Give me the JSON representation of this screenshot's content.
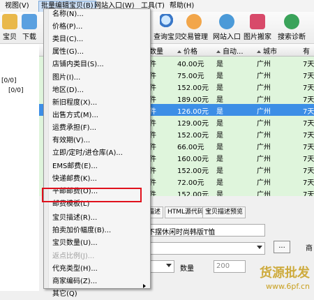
{
  "menubar": {
    "items": [
      "视图(V)",
      "批量编辑宝贝(B)",
      "网站入口(W)",
      "工具(T)",
      "帮助(H)"
    ]
  },
  "toolbar": {
    "items": [
      "宝贝",
      "下载",
      "查询宝贝",
      "交易管理",
      "网站入口",
      "图片搬家",
      "搜索诊断"
    ]
  },
  "lefttree": {
    "counts": [
      "[0/0]",
      "[0/0]"
    ]
  },
  "grid": {
    "headers": [
      "数量",
      "价格",
      "自动...",
      "城市",
      "有"
    ],
    "rows": [
      {
        "qty": "件",
        "price": "40.00元",
        "auto": "是",
        "city": "广州",
        "days": "7天"
      },
      {
        "qty": "件",
        "price": "75.00元",
        "auto": "是",
        "city": "广州",
        "days": "7天"
      },
      {
        "qty": "件",
        "price": "152.00元",
        "auto": "是",
        "city": "广州",
        "days": "7天"
      },
      {
        "qty": "件",
        "price": "189.00元",
        "auto": "是",
        "city": "广州",
        "days": "7天"
      },
      {
        "qty": "件",
        "price": "126.00元",
        "auto": "是",
        "city": "广州",
        "days": "7天"
      },
      {
        "qty": "件",
        "price": "129.00元",
        "auto": "是",
        "city": "广州",
        "days": "7天"
      },
      {
        "qty": "件",
        "price": "152.00元",
        "auto": "是",
        "city": "广州",
        "days": "7天"
      },
      {
        "qty": "件",
        "price": "66.00元",
        "auto": "是",
        "city": "广州",
        "days": "7天"
      },
      {
        "qty": "件",
        "price": "160.00元",
        "auto": "是",
        "city": "广州",
        "days": "7天"
      },
      {
        "qty": "件",
        "price": "152.00元",
        "auto": "是",
        "city": "广州",
        "days": "7天"
      },
      {
        "qty": "件",
        "price": "72.00元",
        "auto": "是",
        "city": "广州",
        "days": "7天"
      },
      {
        "qty": "件",
        "price": "152.00元",
        "auto": "是",
        "city": "广州",
        "days": "7天"
      }
    ]
  },
  "lower": {
    "tabs": [
      "描述",
      "HTML源代码",
      "宝贝描述预览"
    ],
    "title_value": "不摆休闲时尚韩版T恤",
    "qty_label": "数量",
    "qty_value": "200",
    "more_button": "...",
    "right_cut": "商"
  },
  "menu": {
    "items": [
      {
        "label": "名称(N)...",
        "enabled": true
      },
      {
        "label": "价格(P)...",
        "enabled": true
      },
      {
        "label": "类目(C)...",
        "enabled": true
      },
      {
        "label": "属性(G)...",
        "enabled": true
      },
      {
        "label": "店铺内类目(S)...",
        "enabled": true
      },
      {
        "label": "图片(I)...",
        "enabled": true
      },
      {
        "label": "地区(D)...",
        "enabled": true
      },
      {
        "label": "新旧程度(X)...",
        "enabled": true
      },
      {
        "label": "出售方式(M)...",
        "enabled": true
      },
      {
        "label": "运费承担(F)...",
        "enabled": true
      },
      {
        "label": "有效期(V)...",
        "enabled": true
      },
      {
        "label": "立即/定时/进仓库(A)...",
        "enabled": true
      },
      {
        "label": "EMS邮费(E)...",
        "enabled": true
      },
      {
        "label": "快递邮费(K)...",
        "enabled": true
      },
      {
        "label": "平邮邮费(O)...",
        "enabled": true
      },
      {
        "label": "邮费模板(L)",
        "enabled": true
      },
      {
        "label": "宝贝描述(R)...",
        "enabled": true
      },
      {
        "label": "拍卖加价幅度(B)...",
        "enabled": true
      },
      {
        "label": "宝贝数量(U)...",
        "enabled": true
      },
      {
        "label": "返点比例(J)...",
        "enabled": false
      },
      {
        "label": "代充类型(H)...",
        "enabled": true
      },
      {
        "label": "商家编码(Z)...",
        "enabled": true
      },
      {
        "label": "其它(Q)",
        "enabled": true
      }
    ]
  },
  "watermark": {
    "text": "货源批发",
    "url": "www.6pf.cn"
  },
  "colors": {
    "row_green": "#dff5dc",
    "row_selected": "#3d8ee6",
    "highlight_red": "#e0101c",
    "menu_active": "#cfe2f8"
  }
}
